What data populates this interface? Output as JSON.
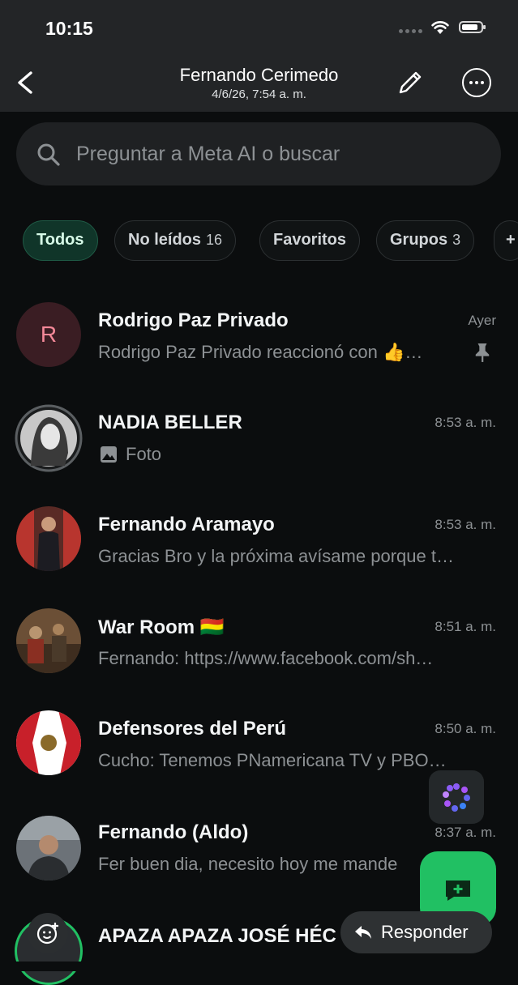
{
  "status_bar": {
    "time": "10:15"
  },
  "nav": {
    "title": "Fernando Cerimedo",
    "subtitle": "4/6/26, 7:54 a. m."
  },
  "search": {
    "placeholder": "Preguntar a Meta AI o buscar"
  },
  "filters": [
    {
      "label": "Todos",
      "count": "",
      "active": true
    },
    {
      "label": "No leídos",
      "count": "16",
      "active": false
    },
    {
      "label": "Favoritos",
      "count": "",
      "active": false
    },
    {
      "label": "Grupos",
      "count": "3",
      "active": false
    },
    {
      "label": "+",
      "count": "",
      "active": false
    }
  ],
  "chats": [
    {
      "name": "Rodrigo Paz Privado",
      "time": "Ayer",
      "preview": "Rodrigo Paz Privado reaccionó con 👍…",
      "avatar_letter": "R",
      "pinned": true
    },
    {
      "name": "NADIA BELLER",
      "time": "8:53 a. m.",
      "preview": "Foto",
      "preview_icon": "photo-icon"
    },
    {
      "name": "Fernando Aramayo",
      "time": "8:53 a. m.",
      "preview": "Gracias Bro y la próxima avísame porque t…"
    },
    {
      "name": "War Room 🇧🇴",
      "time": "8:51 a. m.",
      "preview": "Fernando: https://www.facebook.com/sh…"
    },
    {
      "name": "Defensores del Perú",
      "time": "8:50 a. m.",
      "preview": "Cucho: Tenemos PNamericana TV y PBO…"
    },
    {
      "name": "Fernando (Aldo)",
      "time": "8:37 a. m.",
      "preview": "Fer buen dia, necesito hoy me mande"
    },
    {
      "name": "APAZA APAZA JOSÉ HÉC",
      "time": "",
      "preview": ""
    }
  ],
  "reply_button": {
    "label": "Responder"
  },
  "colors": {
    "accent": "#21c063",
    "background": "#0b0d0e",
    "header": "#232527"
  }
}
